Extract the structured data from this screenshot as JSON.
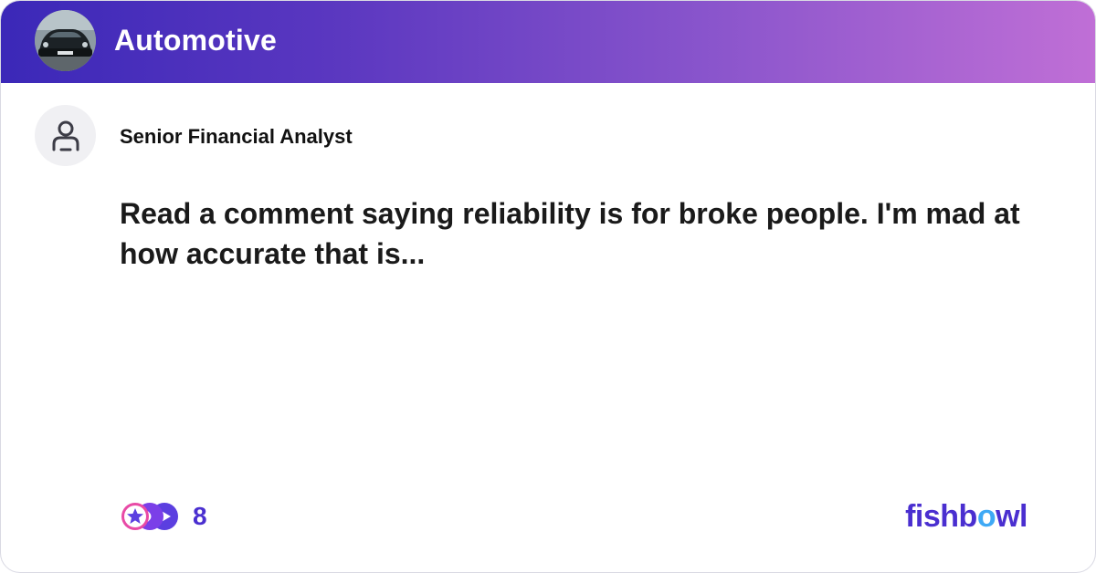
{
  "header": {
    "bowl_name": "Automotive",
    "avatar_icon": "car-photo-icon",
    "gradient_start": "#3b28b8",
    "gradient_end": "#c06fd6"
  },
  "post": {
    "author_title": "Senior Financial Analyst",
    "author_icon": "user-icon",
    "text": "Read a comment saying reliability is for broke people. I'm mad at how accurate that is..."
  },
  "footer": {
    "reaction_count": "8",
    "reaction_icons": [
      "star-reaction-icon",
      "thumbs-reaction-icon",
      "fish-reaction-icon"
    ],
    "logo_prefix": "fishb",
    "logo_o": "o",
    "logo_suffix": "wl",
    "brand_color": "#4a2fd0"
  }
}
